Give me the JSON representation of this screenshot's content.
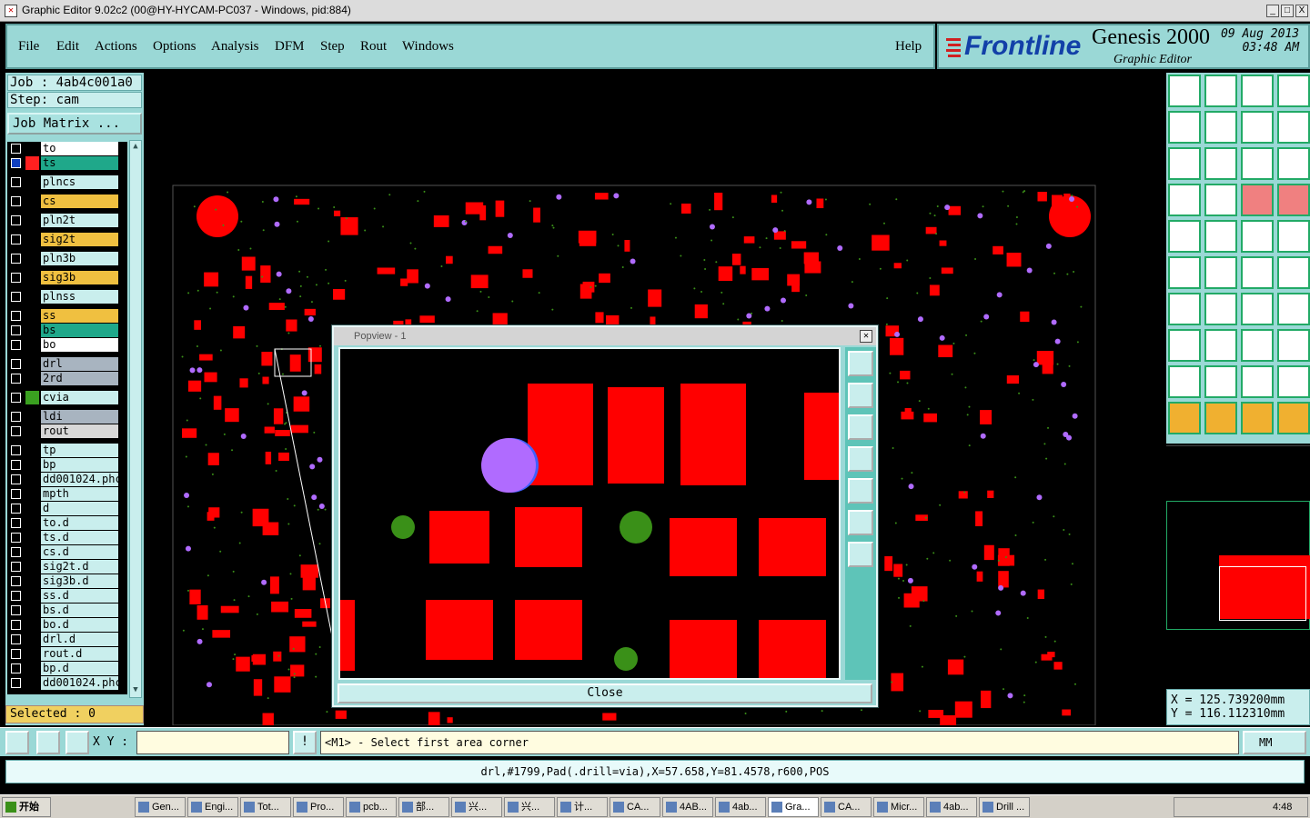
{
  "window": {
    "title": "Graphic Editor 9.02c2 (00@HY-HYCAM-PC037 - Windows, pid:884)",
    "controls": [
      "_",
      "□",
      "X"
    ]
  },
  "menu": {
    "items": [
      "File",
      "Edit",
      "Actions",
      "Options",
      "Analysis",
      "DFM",
      "Step",
      "Rout",
      "Windows"
    ],
    "help": "Help"
  },
  "logo": {
    "brand": "Frontline",
    "product": "Genesis 2000",
    "subtitle": "Graphic Editor",
    "date": "09 Aug 2013",
    "time": "03:48 AM"
  },
  "job": {
    "job_label": "Job : 4ab4c001a0",
    "step_label": "Step: cam",
    "matrix_button": "Job Matrix ..."
  },
  "layers": [
    {
      "name": "to",
      "color": "#ffffff",
      "mark": "⬋",
      "swatch": "#000000"
    },
    {
      "name": "ts",
      "color": "#1fa88a",
      "mark": "⊞",
      "swatch": "#ff2020",
      "active": true
    },
    {
      "name": "plncs",
      "color": "#c9eeed",
      "mark": "",
      "swatch": "#000000"
    },
    {
      "name": "cs",
      "color": "#f0c040",
      "mark": "⬋",
      "swatch": "#000000"
    },
    {
      "name": "pln2t",
      "color": "#c9eeed",
      "mark": "",
      "swatch": "#000000"
    },
    {
      "name": "sig2t",
      "color": "#f0c040",
      "mark": "⬋",
      "swatch": "#000000"
    },
    {
      "name": "pln3b",
      "color": "#c9eeed",
      "mark": "",
      "swatch": "#000000"
    },
    {
      "name": "sig3b",
      "color": "#f0c040",
      "mark": "⬋",
      "swatch": "#000000"
    },
    {
      "name": "plnss",
      "color": "#c9eeed",
      "mark": "",
      "swatch": "#000000"
    },
    {
      "name": "ss",
      "color": "#f0c040",
      "mark": "⬋",
      "swatch": "#000000"
    },
    {
      "name": "bs",
      "color": "#1fa88a",
      "mark": "",
      "swatch": "#000000"
    },
    {
      "name": "bo",
      "color": "#ffffff",
      "mark": "⬋",
      "swatch": "#000000"
    },
    {
      "name": "drl",
      "color": "#a8b4c0",
      "mark": "",
      "swatch": "#000000"
    },
    {
      "name": "2rd",
      "color": "#a8b4c0",
      "mark": "",
      "swatch": "#000000"
    },
    {
      "name": "cvia",
      "color": "#c9eeed",
      "mark": "",
      "swatch": "#3aa020"
    },
    {
      "name": "ldi",
      "color": "#a8b4c0",
      "mark": "",
      "swatch": "#000000"
    },
    {
      "name": "rout",
      "color": "#d8d8d8",
      "mark": "",
      "swatch": "#000000"
    },
    {
      "name": "tp",
      "color": "#c9eeed",
      "mark": "",
      "swatch": "#000000"
    },
    {
      "name": "bp",
      "color": "#c9eeed",
      "mark": "",
      "swatch": "#000000"
    },
    {
      "name": "dd001024.phc",
      "color": "#c9eeed",
      "mark": "",
      "swatch": "#000000"
    },
    {
      "name": "mpth",
      "color": "#c9eeed",
      "mark": "",
      "swatch": "#000000"
    },
    {
      "name": "d",
      "color": "#c9eeed",
      "mark": "",
      "swatch": "#000000"
    },
    {
      "name": "to.d",
      "color": "#c9eeed",
      "mark": "⬋",
      "swatch": "#000000"
    },
    {
      "name": "ts.d",
      "color": "#c9eeed",
      "mark": "",
      "swatch": "#000000"
    },
    {
      "name": "cs.d",
      "color": "#c9eeed",
      "mark": "⬋",
      "swatch": "#000000"
    },
    {
      "name": "sig2t.d",
      "color": "#c9eeed",
      "mark": "⬋",
      "swatch": "#000000"
    },
    {
      "name": "sig3b.d",
      "color": "#c9eeed",
      "mark": "⬋",
      "swatch": "#000000"
    },
    {
      "name": "ss.d",
      "color": "#c9eeed",
      "mark": "⬋",
      "swatch": "#000000"
    },
    {
      "name": "bs.d",
      "color": "#c9eeed",
      "mark": "",
      "swatch": "#000000"
    },
    {
      "name": "bo.d",
      "color": "#c9eeed",
      "mark": "⬋",
      "swatch": "#000000"
    },
    {
      "name": "drl.d",
      "color": "#c9eeed",
      "mark": "",
      "swatch": "#000000"
    },
    {
      "name": "rout.d",
      "color": "#c9eeed",
      "mark": "",
      "swatch": "#000000"
    },
    {
      "name": "bp.d",
      "color": "#c9eeed",
      "mark": "",
      "swatch": "#000000"
    },
    {
      "name": "dd001024.phc",
      "color": "#c9eeed",
      "mark": "",
      "swatch": "#000000"
    }
  ],
  "selected": "Selected : 0",
  "popview": {
    "title": "Popview - 1",
    "close_label": "Close"
  },
  "toolbar_icons": [
    "zoom-home-icon",
    "zoom-out-icon",
    "zoom-window-icon",
    "zoom-area-icon",
    "pan-left-icon",
    "pan-right-icon",
    "zoom-back-icon",
    "redraw-icon",
    "fit-icon",
    "center-icon",
    "one-to-one-icon",
    "query-icon",
    "measure-icon",
    "grid-icon",
    "snap-icon",
    "snap-alt-icon",
    "fill-icon",
    "layer-color-icon",
    "ruler-icon",
    "pad-icon",
    "connect-icon",
    "cross-icon",
    "move-icon",
    "rotate-icon",
    "angle-icon",
    "line-icon",
    "arc-icon",
    "mirror-icon",
    "copy-icon",
    "minus-icon",
    "resize-icon",
    "group-icon",
    "triangle-icon",
    "warn-icon",
    "select-icon",
    "select-alt-icon",
    "pointer-icon",
    "pointer-box-icon",
    "pointer-lasso-icon",
    "pointer-multi-icon"
  ],
  "coords": {
    "x": "X  =  125.739200mm",
    "y": "Y  =  116.112310mm"
  },
  "cmd": {
    "xy_label": "X Y :",
    "xy_value": "",
    "prompt": "<M1> - Select first area corner",
    "units": "MM"
  },
  "status": "drl,#1799,Pad(.drill=via),X=57.658,Y=81.4578,r600,POS",
  "taskbar": {
    "start": "开始",
    "tasks": [
      "Gen...",
      "Engi...",
      "Tot...",
      "Pro...",
      "pcb...",
      "部...",
      "兴...",
      "兴...",
      "计...",
      "CA...",
      "4AB...",
      "4ab...",
      "Gra...",
      "CA...",
      "Micr...",
      "4ab...",
      "Drill ..."
    ],
    "clock": "4:48"
  },
  "colors": {
    "pad": "#ff0000",
    "via": "#b06bff",
    "drill": "#3a9018",
    "panel": "#9ad8d6",
    "accent": "#1240a8"
  }
}
